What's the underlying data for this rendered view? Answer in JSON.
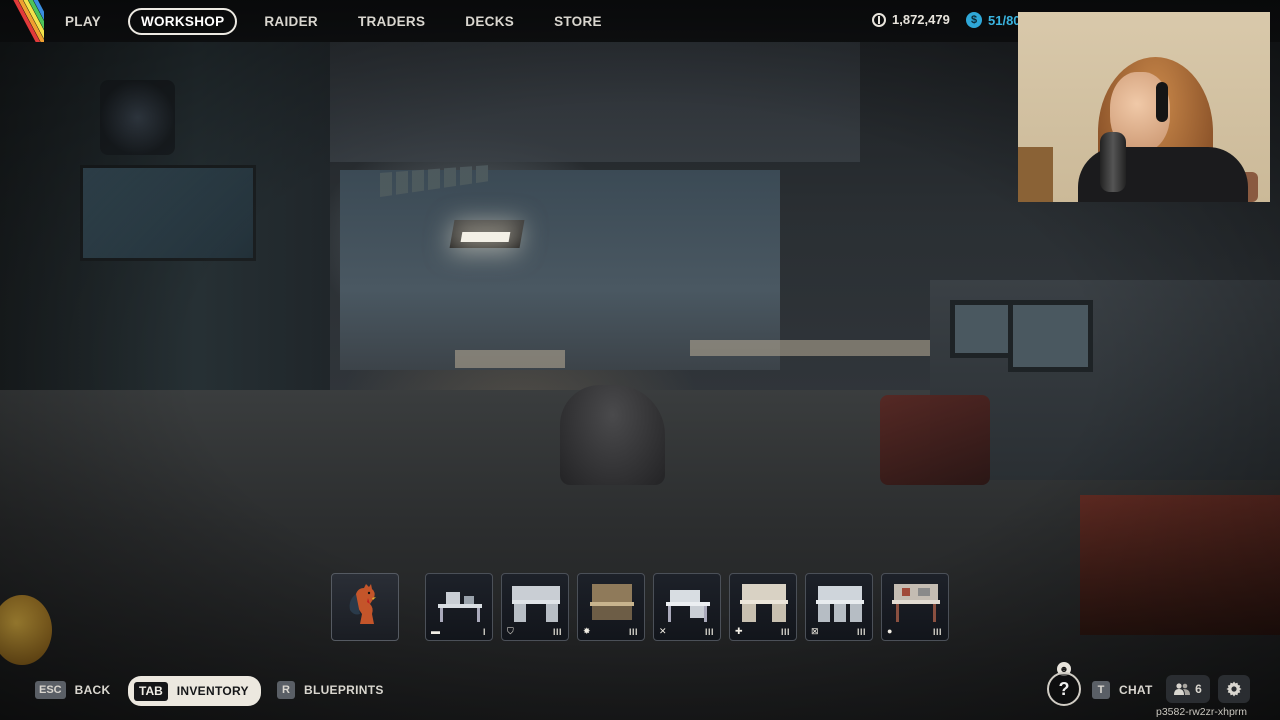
{
  "nav": {
    "items": [
      {
        "label": "PLAY",
        "active": false
      },
      {
        "label": "WORKSHOP",
        "active": true
      },
      {
        "label": "RAIDER",
        "active": false
      },
      {
        "label": "TRADERS",
        "active": false
      },
      {
        "label": "DECKS",
        "active": false
      },
      {
        "label": "STORE",
        "active": false
      }
    ]
  },
  "currency": {
    "coins": "1,872,479",
    "creds": "51/80"
  },
  "slots": [
    {
      "name": "rooster",
      "icon": "",
      "level": ""
    },
    {
      "name": "workbench-1",
      "icon": "bed-icon",
      "level": "I"
    },
    {
      "name": "workbench-2",
      "icon": "shield-icon",
      "level": "III"
    },
    {
      "name": "workbench-3",
      "icon": "explosive-icon",
      "level": "III"
    },
    {
      "name": "workbench-4",
      "icon": "crossed-tools-icon",
      "level": "III"
    },
    {
      "name": "workbench-5",
      "icon": "medical-cross-icon",
      "level": "III"
    },
    {
      "name": "workbench-6",
      "icon": "utility-icon",
      "level": "III"
    },
    {
      "name": "workbench-7",
      "icon": "seed-icon",
      "level": "III"
    }
  ],
  "bottom": {
    "back": {
      "key": "ESC",
      "label": "BACK"
    },
    "inventory": {
      "key": "TAB",
      "label": "INVENTORY"
    },
    "blueprints": {
      "key": "R",
      "label": "BLUEPRINTS"
    },
    "chat": {
      "key": "T",
      "label": "CHAT"
    },
    "friends_count": "6",
    "help": "?",
    "session_id": "p3582-rw2zr-xhprm"
  },
  "colors": {
    "accent_creds": "#3ab4e0",
    "logo_stripes": [
      "#e23a3a",
      "#f0a030",
      "#f2e24a",
      "#4cc45a",
      "#3a8ee0"
    ]
  }
}
